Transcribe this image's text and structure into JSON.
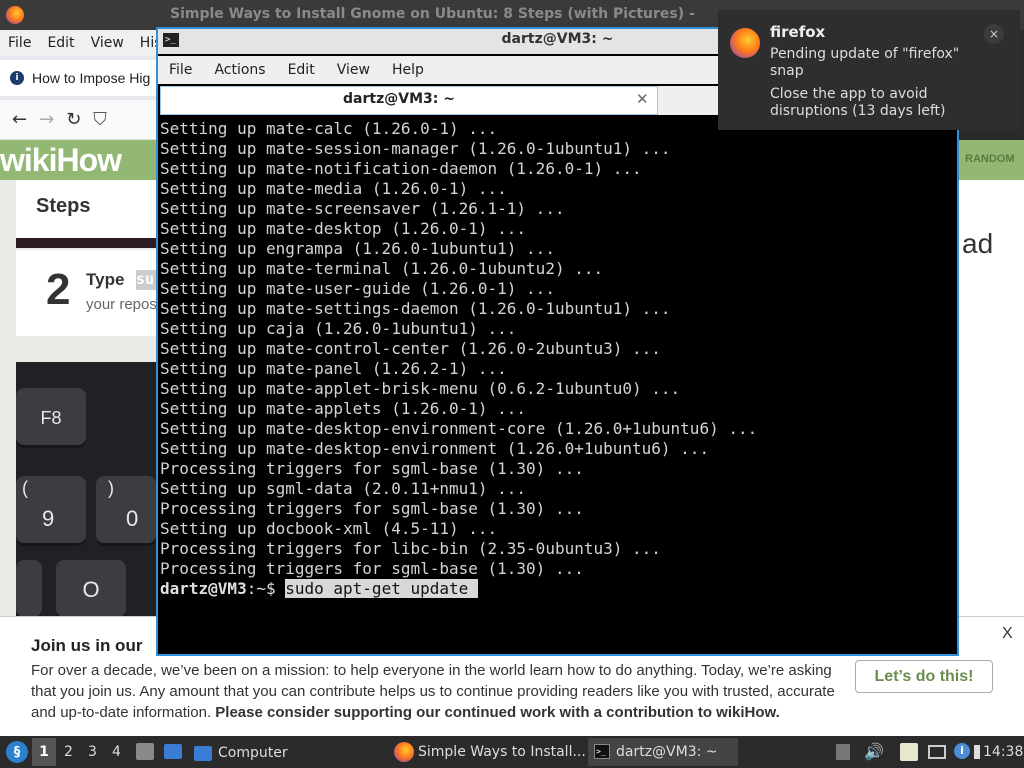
{
  "firefox": {
    "window_title": "Simple Ways to Install Gnome on Ubuntu: 8 Steps (with Pictures) -",
    "menu": [
      "File",
      "Edit",
      "View",
      "Hist"
    ],
    "tab_title": "How to Impose Hig",
    "wiki": {
      "logo": "wikiHow",
      "random": "RANDOM",
      "steps_label": "Steps",
      "step_number": "2",
      "step_type": "Type",
      "step_code": "su",
      "step_sub": "your repos",
      "right_fragment": "ad",
      "keys": [
        "F8",
        "9",
        "(",
        "0",
        ")",
        "O"
      ]
    },
    "banner": {
      "title": "Join us in our",
      "text": "For over a decade, we’ve been on a mission: to help everyone in the world learn how to do anything. Today, we’re asking that you join us. Any amount that you can contribute helps us to continue providing readers like you with trusted, accurate and up-to-date information.",
      "text_bold": "Please consider supporting our continued work with a contribution to wikiHow.",
      "button": "Let’s do this!",
      "close": "X"
    }
  },
  "terminal": {
    "title": "dartz@VM3: ~",
    "menu": [
      "File",
      "Actions",
      "Edit",
      "View",
      "Help"
    ],
    "tab_label": "dartz@VM3: ~",
    "tab_close": "✕",
    "lines": [
      "Setting up mate-calc (1.26.0-1) ...",
      "Setting up mate-session-manager (1.26.0-1ubuntu1) ...",
      "Setting up mate-notification-daemon (1.26.0-1) ...",
      "Setting up mate-media (1.26.0-1) ...",
      "Setting up mate-screensaver (1.26.1-1) ...",
      "Setting up mate-desktop (1.26.0-1) ...",
      "Setting up engrampa (1.26.0-1ubuntu1) ...",
      "Setting up mate-terminal (1.26.0-1ubuntu2) ...",
      "Setting up mate-user-guide (1.26.0-1) ...",
      "Setting up mate-settings-daemon (1.26.0-1ubuntu1) ...",
      "Setting up caja (1.26.0-1ubuntu1) ...",
      "Setting up mate-control-center (1.26.0-2ubuntu3) ...",
      "Setting up mate-panel (1.26.2-1) ...",
      "Setting up mate-applet-brisk-menu (0.6.2-1ubuntu0) ...",
      "Setting up mate-applets (1.26.0-1) ...",
      "Setting up mate-desktop-environment-core (1.26.0+1ubuntu6) ...",
      "Setting up mate-desktop-environment (1.26.0+1ubuntu6) ...",
      "Processing triggers for sgml-base (1.30) ...",
      "Setting up sgml-data (2.0.11+nmu1) ...",
      "Processing triggers for sgml-base (1.30) ...",
      "Setting up docbook-xml (4.5-11) ...",
      "Processing triggers for libc-bin (2.35-0ubuntu3) ...",
      "Processing triggers for sgml-base (1.30) ..."
    ],
    "prompt": "dartz@VM3",
    "prompt_suffix": ":~$ ",
    "command": "sudo apt-get update "
  },
  "notification": {
    "app": "firefox",
    "message1": "Pending update of \"firefox\" snap",
    "message2": "Close the app to avoid disruptions (13 days left)",
    "close": "×"
  },
  "taskbar": {
    "workspaces": [
      "1",
      "2",
      "3",
      "4"
    ],
    "computer": "Computer",
    "firefox_task": "Simple Ways to Install...",
    "terminal_task": "dartz@VM3: ~",
    "clock": "14:38"
  },
  "colors": {
    "wiki_green": "#93b874",
    "terminal_border": "#2f8fd9",
    "terminal_bg": "#000000"
  }
}
